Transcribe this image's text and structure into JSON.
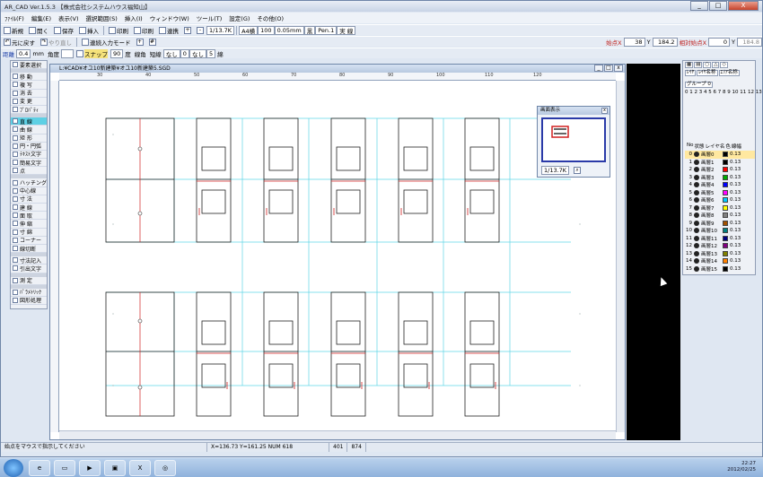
{
  "window": {
    "title": "AR_CAD Ver.1.5.3 【株式会社システムハウス福知山】",
    "min": "_",
    "max": "□",
    "close": "X"
  },
  "menu": [
    "ﾌｧｲﾙ(F)",
    "編集(E)",
    "表示(V)",
    "選択範囲(S)",
    "挿入(I)",
    "ウィンドウ(W)",
    "ツール(T)",
    "設定(G)",
    "その他(O)"
  ],
  "toolbar1": {
    "new": "新規",
    "open": "開く",
    "save": "保存",
    "insert": "挿入",
    "print": "印刷",
    "preview": "印刷",
    "link": "連携",
    "scale": "1/13.7K",
    "paper": "A4横",
    "zoom": "100",
    "pen": "0.05mm",
    "color": "黒",
    "penname": "Pen.1",
    "linetype": "実 線"
  },
  "toolbar2": {
    "undo": "元に戻す",
    "redo": "やり直し",
    "auto": "連続入力モード",
    "start_label": "始点X",
    "x": "38",
    "y_label": "Y",
    "y": "184.2",
    "rel_label": "相対始点X",
    "relx": "0",
    "rely_label": "Y",
    "rely": "184.8"
  },
  "toolbar3": {
    "dist_label": "距離",
    "dist": "0.4",
    "unit": "mm",
    "angle_label": "角度",
    "snap": "スナップ",
    "snap_val": "90",
    "deg": "度",
    "line_label": "線角",
    "kind_label": "短線",
    "none1": "なし",
    "val1": "0",
    "none2": "なし",
    "val2": "5",
    "mode": "綿"
  },
  "palette": [
    "要素選択",
    "移 動",
    "複 写",
    "消 去",
    "変 更",
    "ﾌﾟﾛﾊﾟﾃｨ",
    "直 線",
    "曲 線",
    "矩 形",
    "円・円弧",
    "ﾃｷｽﾄ文字",
    "簡易文字",
    "点",
    "ハッチング",
    "中心線",
    "寸 法",
    "建 線",
    "面 取",
    "伸 縮",
    "寸 綿",
    "コーナー",
    "線切断",
    "寸法記入",
    "引出文字",
    "測 定",
    "ﾊﾟﾗﾒﾄﾘｯｸ",
    "図形処理"
  ],
  "drawing": {
    "title": "L:¥CAD¥オユ10新建築¥オユ10新建築5.SGD",
    "ruler": [
      "30",
      "40",
      "50",
      "60",
      "70",
      "80",
      "90",
      "100",
      "110",
      "120"
    ]
  },
  "overview": {
    "title": "画面表示",
    "scale": "1/13.7K"
  },
  "right_panel": {
    "tabs": [
      "ﾚｲﾔ",
      "ﾚｲﾔ名称",
      "ｴﾘｱ名称"
    ],
    "group": "グループ 0",
    "layer_header": [
      "No",
      "状態",
      "レイヤ名",
      "色",
      "線幅"
    ],
    "layers": [
      {
        "no": "0",
        "name": "画層0",
        "color": "#000000",
        "lw": "0.13"
      },
      {
        "no": "1",
        "name": "画層1",
        "color": "#000000",
        "lw": "0.13"
      },
      {
        "no": "2",
        "name": "画層2",
        "color": "#ff0000",
        "lw": "0.13"
      },
      {
        "no": "3",
        "name": "画層3",
        "color": "#00aa00",
        "lw": "0.13"
      },
      {
        "no": "4",
        "name": "画層4",
        "color": "#0000ff",
        "lw": "0.13"
      },
      {
        "no": "5",
        "name": "画層5",
        "color": "#ff00ff",
        "lw": "0.13"
      },
      {
        "no": "6",
        "name": "画層6",
        "color": "#00c8ff",
        "lw": "0.13"
      },
      {
        "no": "7",
        "name": "画層7",
        "color": "#ffff00",
        "lw": "0.13"
      },
      {
        "no": "8",
        "name": "画層8",
        "color": "#808080",
        "lw": "0.13"
      },
      {
        "no": "9",
        "name": "画層9",
        "color": "#a05000",
        "lw": "0.13"
      },
      {
        "no": "10",
        "name": "画層10",
        "color": "#008080",
        "lw": "0.13"
      },
      {
        "no": "11",
        "name": "画層11",
        "color": "#000080",
        "lw": "0.13"
      },
      {
        "no": "12",
        "name": "画層12",
        "color": "#800080",
        "lw": "0.13"
      },
      {
        "no": "13",
        "name": "画層13",
        "color": "#808000",
        "lw": "0.13"
      },
      {
        "no": "14",
        "name": "画層14",
        "color": "#ff8000",
        "lw": "0.13"
      },
      {
        "no": "15",
        "name": "画層15",
        "color": "#000000",
        "lw": "0.13"
      }
    ]
  },
  "status": {
    "hint": "始点をマウスで指示してください",
    "coords": "X=136.73  Y=161.25  NUM  618",
    "a": "401",
    "b": "874"
  },
  "taskbar": {
    "time": "22:27",
    "date": "2012/02/25"
  }
}
